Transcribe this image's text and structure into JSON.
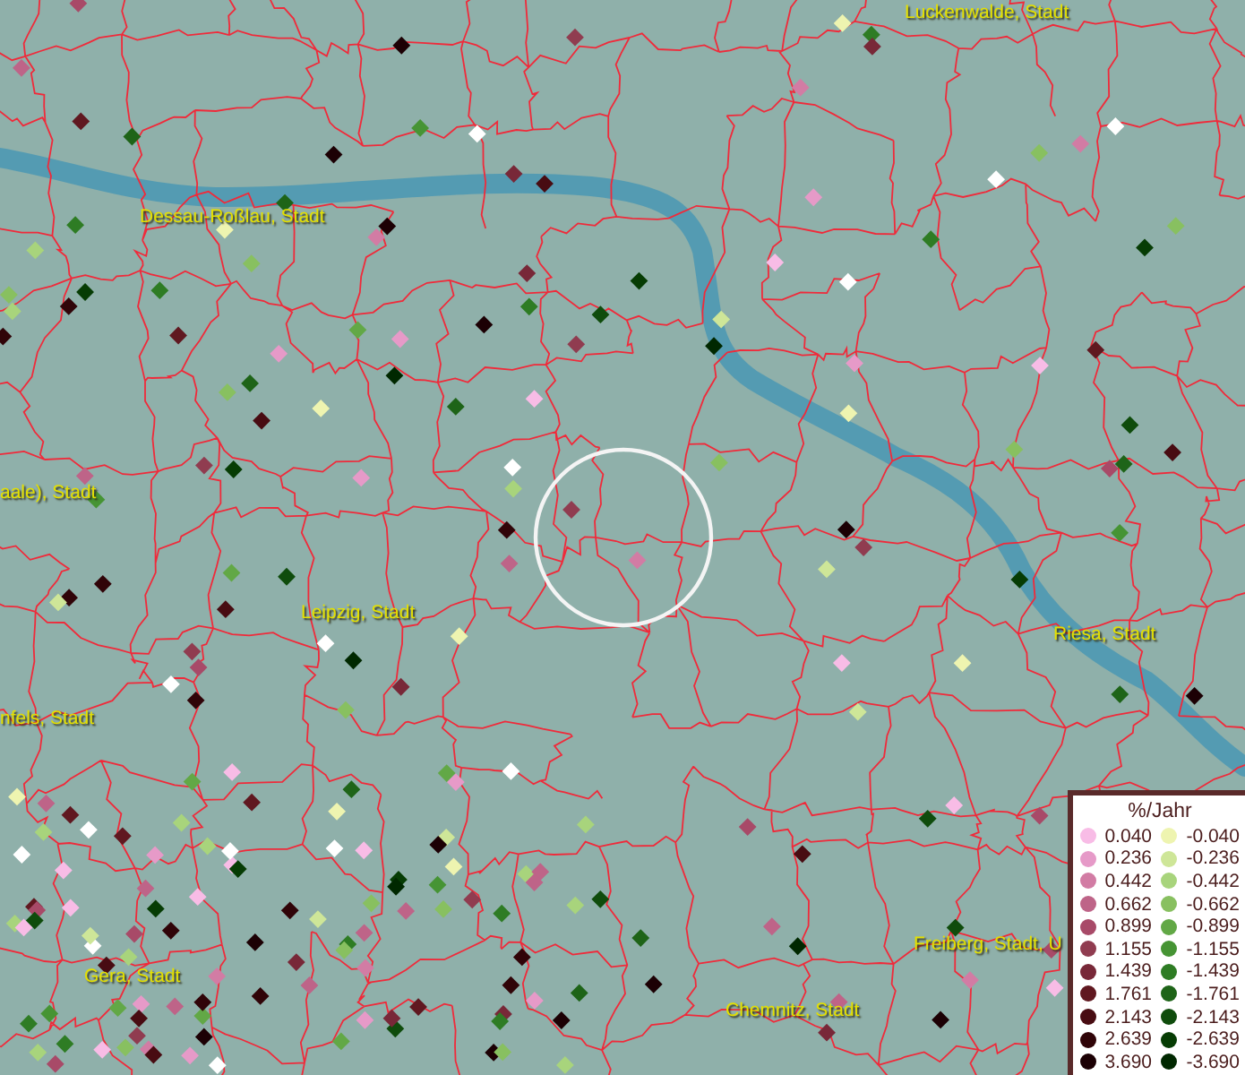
{
  "place_labels": [
    {
      "text": "Luckenwalde, Stadt"
    },
    {
      "text": "Dessau-Roßlau, Stadt"
    },
    {
      "text": "aale), Stadt"
    },
    {
      "text": "Leipzig, Stadt"
    },
    {
      "text": "nfels, Stadt"
    },
    {
      "text": "Riesa, Stadt"
    },
    {
      "text": "Freiberg, Stadt, U"
    },
    {
      "text": "Gera, Stadt"
    },
    {
      "text": "Chemnitz, Stadt"
    }
  ],
  "legend": {
    "title": "%/Jahr",
    "positive": [
      {
        "label": "0.040",
        "color": "#f8bce6"
      },
      {
        "label": "0.236",
        "color": "#e69ac8"
      },
      {
        "label": "0.442",
        "color": "#d27ca4"
      },
      {
        "label": "0.662",
        "color": "#be6488"
      },
      {
        "label": "0.899",
        "color": "#a84a68"
      },
      {
        "label": "1.155",
        "color": "#903c50"
      },
      {
        "label": "1.439",
        "color": "#782838"
      },
      {
        "label": "1.761",
        "color": "#601820"
      },
      {
        "label": "2.143",
        "color": "#480c12"
      },
      {
        "label": "2.639",
        "color": "#300408"
      },
      {
        "label": "3.690",
        "color": "#1c0004"
      }
    ],
    "negative": [
      {
        "label": "-0.040",
        "color": "#eef4b0"
      },
      {
        "label": "-0.236",
        "color": "#cee698"
      },
      {
        "label": "-0.442",
        "color": "#a8d47c"
      },
      {
        "label": "-0.662",
        "color": "#88c060"
      },
      {
        "label": "-0.899",
        "color": "#62a846"
      },
      {
        "label": "-1.155",
        "color": "#469434"
      },
      {
        "label": "-1.439",
        "color": "#2e7c24"
      },
      {
        "label": "-1.761",
        "color": "#1e6418"
      },
      {
        "label": "-2.143",
        "color": "#0f4c0c"
      },
      {
        "label": "-2.639",
        "color": "#063c04"
      },
      {
        "label": "-3.690",
        "color": "#002800"
      }
    ]
  }
}
